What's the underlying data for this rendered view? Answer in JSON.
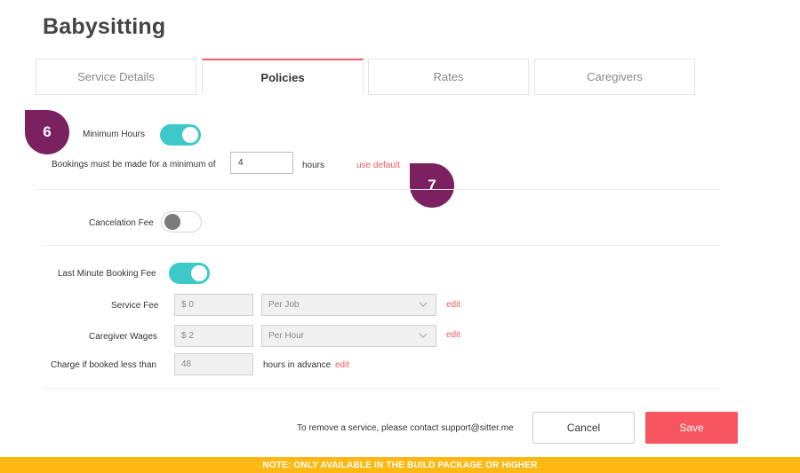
{
  "page": {
    "title": "Babysitting"
  },
  "tabs": [
    {
      "label": "Service Details",
      "active": false
    },
    {
      "label": "Policies",
      "active": true
    },
    {
      "label": "Rates",
      "active": false
    },
    {
      "label": "Caregivers",
      "active": false
    }
  ],
  "badges": {
    "first": "6",
    "second": "7"
  },
  "minimum_hours": {
    "label": "Minimum Hours",
    "enabled": true,
    "description": "Bookings must be made for a minimum of",
    "value": "4",
    "unit": "hours",
    "default_link": "use default"
  },
  "cancelation_fee": {
    "label": "Cancelation Fee",
    "enabled": false
  },
  "last_minute": {
    "label": "Last Minute Booking Fee",
    "enabled": true,
    "service_fee": {
      "label": "Service Fee",
      "value": "$ 0",
      "period": "Per Job",
      "edit": "edit"
    },
    "caregiver_wages": {
      "label": "Caregiver Wages",
      "value": "$ 2",
      "period": "Per Hour",
      "edit": "edit"
    },
    "charge_if": {
      "label": "Charge if booked less than",
      "value": "48",
      "suffix": "hours in advance",
      "edit": "edit"
    }
  },
  "footer": {
    "note": "To remove a service, please contact support@sitter.me",
    "cancel_label": "Cancel",
    "save_label": "Save",
    "banner": "NOTE: ONLY AVAILABLE IN THE BUILD PACKAGE OR HIGHER"
  },
  "colors": {
    "accent": "#f25a66",
    "toggle_on": "#3ec9c9",
    "badge": "#7b2160",
    "banner": "#fdb813"
  }
}
